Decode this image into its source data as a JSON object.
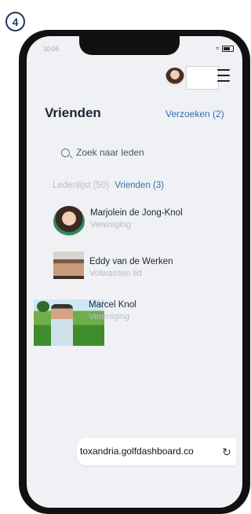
{
  "step": "4",
  "status_bar": {
    "time": "10:05"
  },
  "header": {
    "title": "Vrienden",
    "requests_link": "Verzoeken (2)"
  },
  "search": {
    "placeholder": "Zoek naar leden"
  },
  "tabs": [
    {
      "label": "Ledenlijst (50)",
      "active": false
    },
    {
      "label": "Vrienden (3)",
      "active": true
    }
  ],
  "members": [
    {
      "name": "Marjolein de Jong-Knol",
      "role": "Vereniging"
    },
    {
      "name": "Eddy van de Werken",
      "role": "Volwassen lid"
    },
    {
      "name": "Marcel Knol",
      "role": "Vereniging"
    }
  ],
  "browser": {
    "url": "toxandria.golfdashboard.co"
  },
  "colors": {
    "accent": "#2f6fb0",
    "muted": "#b7bcc6",
    "badge": "#1c3a5e"
  },
  "icons": [
    "search-icon",
    "menu-icon",
    "refresh-icon",
    "wifi-icon",
    "battery-icon"
  ]
}
